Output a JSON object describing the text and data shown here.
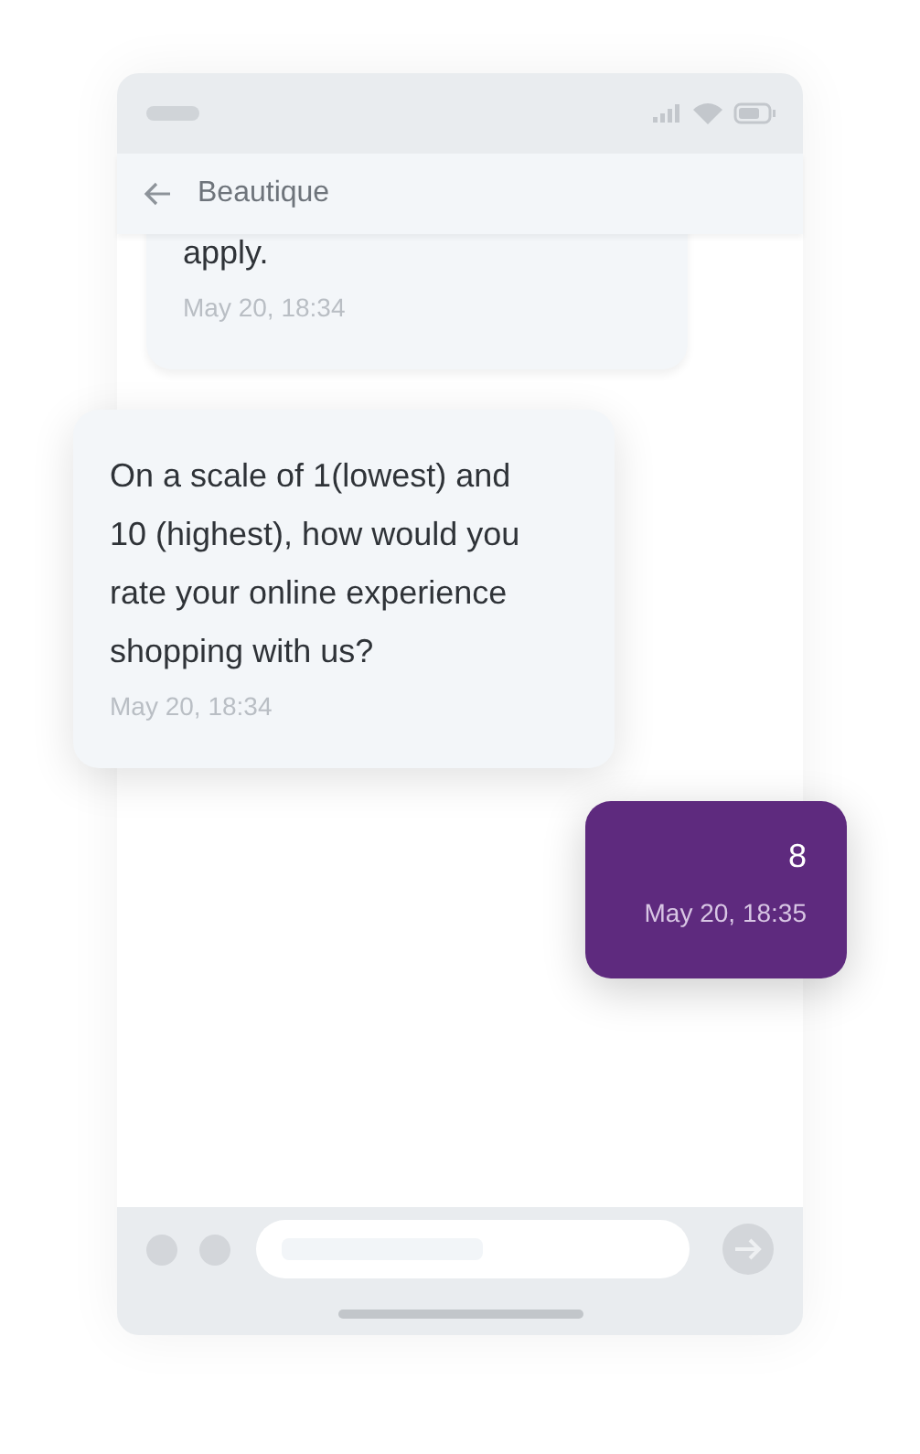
{
  "header": {
    "title": "Beautique"
  },
  "messages": [
    {
      "kind": "incoming",
      "text": "apply.",
      "time": "May 20, 18:34"
    },
    {
      "kind": "incoming",
      "text": "On a scale of 1(lowest) and 10 (highest), how would you rate your online experience shopping with us?",
      "time": "May 20, 18:34"
    },
    {
      "kind": "outgoing",
      "text": "8",
      "time": "May 20, 18:35"
    }
  ]
}
